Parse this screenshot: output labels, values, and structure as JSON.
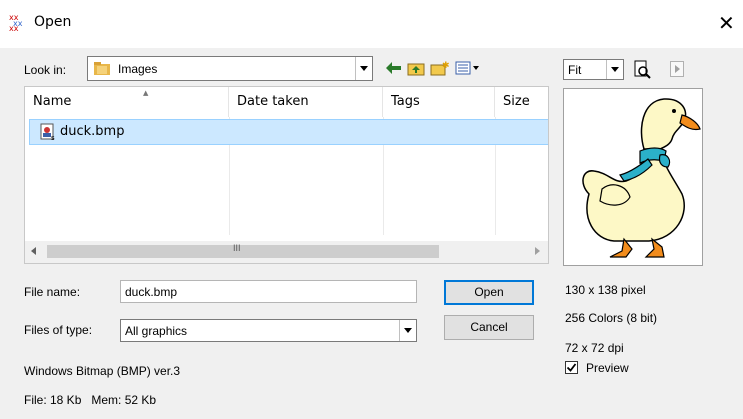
{
  "window": {
    "title": "Open",
    "close_glyph": "✕"
  },
  "look_in": {
    "label": "Look in:",
    "value": "Images",
    "folder_icon": "folder-icon"
  },
  "toolbar": {
    "icons": [
      "back-arrow-icon",
      "up-folder-icon",
      "new-folder-icon",
      "view-menu-icon"
    ]
  },
  "file_list": {
    "columns": [
      "Name",
      "Date taken",
      "Tags",
      "Size"
    ],
    "sort_indicator": "▲",
    "rows": [
      {
        "name": "duck.bmp",
        "icon": "bitmap-file-icon"
      }
    ],
    "scroll_grip": "III"
  },
  "file_name": {
    "label": "File name:",
    "value": "duck.bmp"
  },
  "files_of_type": {
    "label": "Files of type:",
    "value": "All graphics"
  },
  "buttons": {
    "open": "Open",
    "cancel": "Cancel"
  },
  "file_info": {
    "format": "Windows Bitmap (BMP) ver.3",
    "size": "File: 18 Kb   Mem: 52 Kb"
  },
  "preview": {
    "zoom_value": "Fit",
    "dimensions": "130 x 138 pixel",
    "colors": "256 Colors (8 bit)",
    "dpi": "72 x 72 dpi",
    "preview_checkbox_label": "Preview",
    "preview_checked": true
  }
}
